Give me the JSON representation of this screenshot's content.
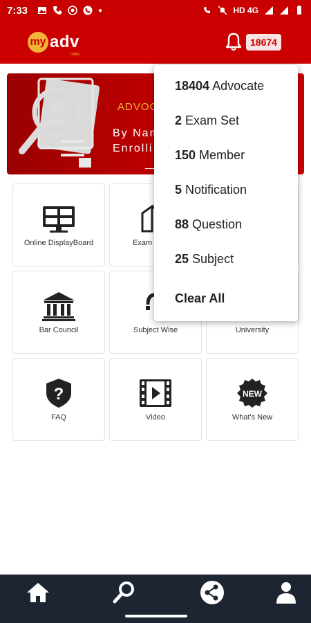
{
  "status_bar": {
    "time": "7:33",
    "network": "HD 4G"
  },
  "app_bar": {
    "logo_circle": "my",
    "logo_text": "adv",
    "logo_sub": "India",
    "notification_count": "18674",
    "colors": {
      "primary": "#cc0000",
      "accent": "#f2b436"
    }
  },
  "banner": {
    "title": "ADVOC",
    "line1": "By Nam",
    "line2": "Enrolli",
    "dashes": "— —"
  },
  "tiles": [
    {
      "label": "Online DisplayBoard",
      "icon": "display-board-icon"
    },
    {
      "label": "Exam",
      "icon": "exam-icon"
    },
    {
      "label": "",
      "icon": ""
    },
    {
      "label": "Bar Council",
      "icon": "bar-council-icon"
    },
    {
      "label": "Subject Wise",
      "icon": "subject-wise-icon"
    },
    {
      "label": "University",
      "icon": "university-icon"
    },
    {
      "label": "FAQ",
      "icon": "faq-shield-icon"
    },
    {
      "label": "Video",
      "icon": "video-icon"
    },
    {
      "label": "What's New",
      "icon": "new-badge-icon"
    }
  ],
  "notifications": {
    "items": [
      {
        "count": "18404",
        "label": " Advocate"
      },
      {
        "count": "2",
        "label": " Exam Set"
      },
      {
        "count": "150",
        "label": " Member"
      },
      {
        "count": "5",
        "label": " Notification"
      },
      {
        "count": "88",
        "label": " Question"
      },
      {
        "count": "25",
        "label": " Subject"
      }
    ],
    "clear_all": "Clear All"
  },
  "new_badge_text": "NEW",
  "bottom_nav": [
    "home-icon",
    "search-icon",
    "share-icon",
    "profile-icon"
  ]
}
